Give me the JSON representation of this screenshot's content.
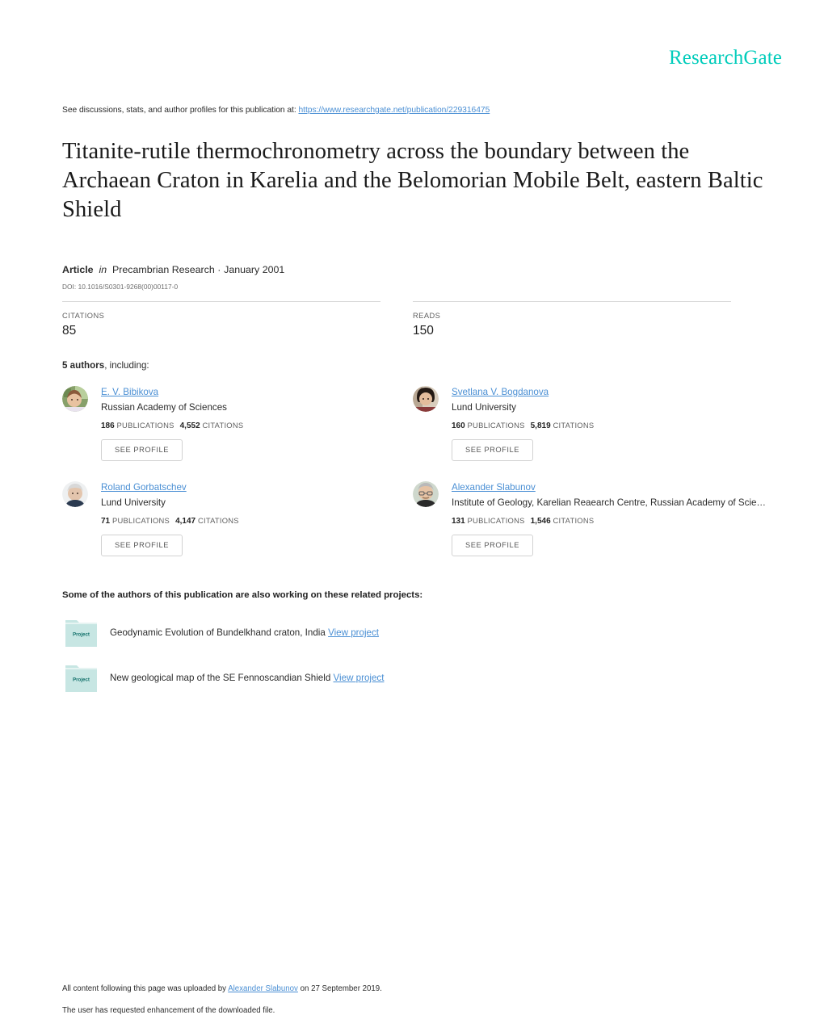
{
  "brand": {
    "logo_text": "ResearchGate",
    "accent_color": "#00ccbb",
    "link_color": "#4a8fd4"
  },
  "header": {
    "discussions_prefix": "See discussions, stats, and author profiles for this publication at: ",
    "publication_url": "https://www.researchgate.net/publication/229316475"
  },
  "publication": {
    "title": "Titanite-rutile thermochronometry across the boundary between the Archaean Craton in Karelia and the Belomorian Mobile Belt, eastern Baltic Shield",
    "type_label": "Article",
    "in_label": "in",
    "journal": "Precambrian Research",
    "separator": "·",
    "date": "January 2001",
    "doi": "DOI: 10.1016/S0301-9268(00)00117-0"
  },
  "stats": {
    "citations_label": "CITATIONS",
    "citations_value": "85",
    "reads_label": "READS",
    "reads_value": "150"
  },
  "authors_section": {
    "count_text": "5 authors",
    "including_text": ", including:",
    "see_profile_label": "SEE PROFILE",
    "publications_label": "PUBLICATIONS",
    "citations_label": "CITATIONS",
    "authors": [
      {
        "name": "E. V. Bibikova",
        "affiliation": "Russian Academy of Sciences",
        "publications": "186",
        "citations": "4,552",
        "avatar_name": "avatar-bibikova"
      },
      {
        "name": "Svetlana V. Bogdanova",
        "affiliation": "Lund University",
        "publications": "160",
        "citations": "5,819",
        "avatar_name": "avatar-bogdanova"
      },
      {
        "name": "Roland Gorbatschev",
        "affiliation": "Lund University",
        "publications": "71",
        "citations": "4,147",
        "avatar_name": "avatar-gorbatschev"
      },
      {
        "name": "Alexander Slabunov",
        "affiliation": "Institute of Geology, Karelian Reaearch Centre, Russian Academy of Scie…",
        "publications": "131",
        "citations": "1,546",
        "avatar_name": "avatar-slabunov"
      }
    ]
  },
  "projects_section": {
    "heading": "Some of the authors of this publication are also working on these related projects:",
    "folder_label": "Project",
    "view_label": "View project",
    "projects": [
      {
        "title": "Geodynamic Evolution of Bundelkhand craton, India"
      },
      {
        "title": "New geological map of the SE Fennoscandian Shield"
      }
    ]
  },
  "footer": {
    "upload_prefix": "All content following this page was uploaded by ",
    "uploader": "Alexander Slabunov",
    "upload_suffix": " on 27 September 2019.",
    "enhancement_note": "The user has requested enhancement of the downloaded file."
  }
}
